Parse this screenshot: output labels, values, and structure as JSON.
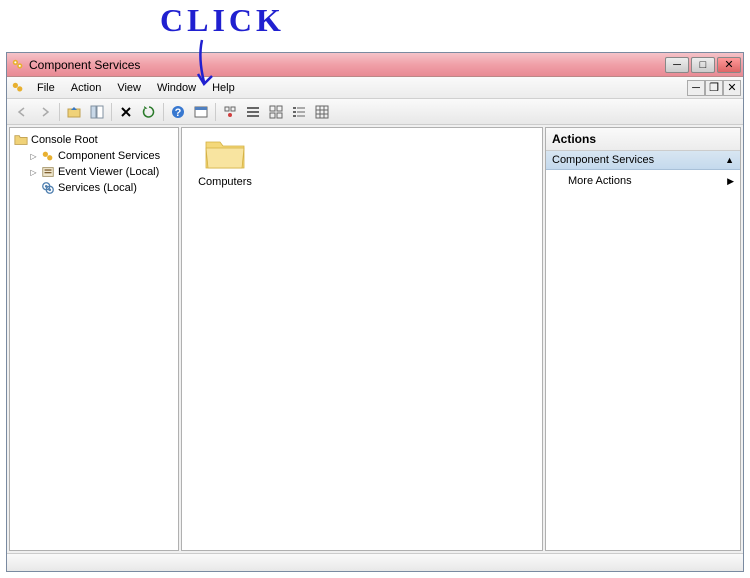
{
  "annotation": {
    "text": "CLICK"
  },
  "window": {
    "title": "Component Services"
  },
  "menu": {
    "file": "File",
    "action": "Action",
    "view": "View",
    "window": "Window",
    "help": "Help"
  },
  "toolbar": {
    "back": "back-icon",
    "forward": "forward-icon",
    "up": "up-icon",
    "show_hide": "show-hide-console-tree-icon",
    "delete": "delete-icon",
    "refresh": "refresh-icon",
    "help": "help-icon",
    "target": "target-icon",
    "b1": "extra-icon-1",
    "b2": "extra-icon-2",
    "b3": "extra-icon-3",
    "b4": "extra-icon-4",
    "b5": "extra-icon-5",
    "b6": "extra-icon-6"
  },
  "tree": {
    "root": "Console Root",
    "items": [
      {
        "label": "Component Services",
        "icon": "component-services-icon"
      },
      {
        "label": "Event Viewer (Local)",
        "icon": "event-viewer-icon"
      },
      {
        "label": "Services (Local)",
        "icon": "services-icon"
      }
    ]
  },
  "content": {
    "items": [
      {
        "label": "Computers",
        "icon": "folder-icon"
      }
    ]
  },
  "actions": {
    "header": "Actions",
    "group": "Component Services",
    "more": "More Actions"
  }
}
